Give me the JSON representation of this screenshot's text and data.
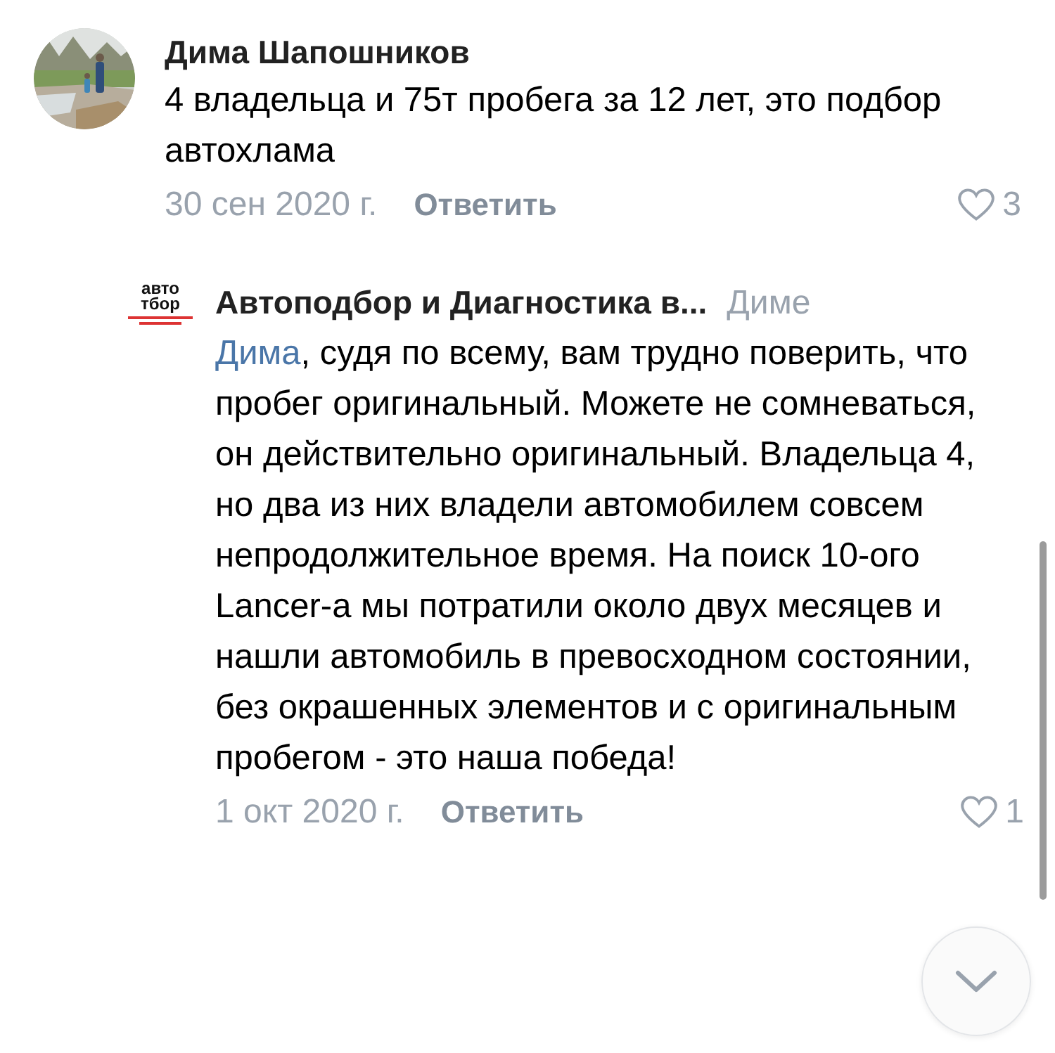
{
  "comment": {
    "author": "Дима Шапошников",
    "text": "4 владельца и 75т пробега за 12 лет, это подбор автохлама",
    "date": "30 сен 2020 г.",
    "reply_action": "Ответить",
    "likes": "3",
    "liked": false
  },
  "reply": {
    "logo": [
      "авто",
      "тбор"
    ],
    "author": "Автоподбор и Диагностика в...",
    "addressee": "Диме",
    "mention": "Дима",
    "text": ", судя по всему, вам трудно поверить, что пробег оригинальный. Можете не сомневаться, он действительно оригинальный. Владельца 4, но два из них владели автомобилем совсем непродолжительное время. На поиск 10-ого Lancer-а мы потратили около двух месяцев и нашли автомобиль в превосходном состоянии, без окрашенных элементов и с оригинальным пробегом - это наша победа!",
    "date": "1 окт 2020 г.",
    "reply_action": "Ответить",
    "likes": "1",
    "liked": false
  }
}
